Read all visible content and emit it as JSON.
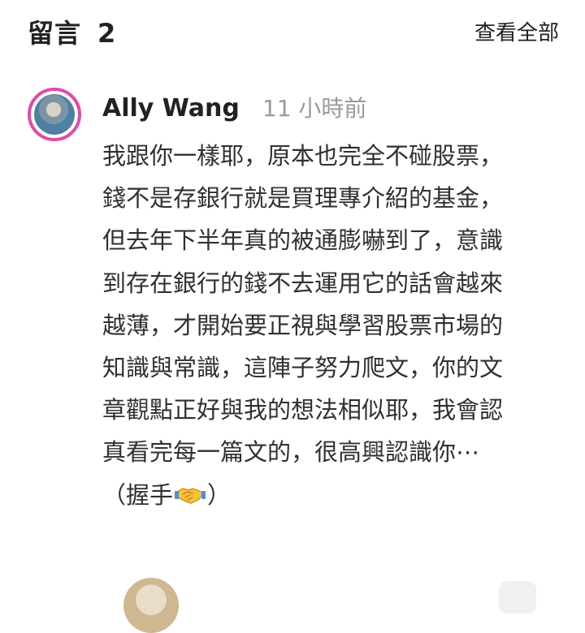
{
  "header": {
    "title": "留言",
    "count": "2",
    "view_all": "查看全部"
  },
  "comment": {
    "author": "Ally Wang",
    "time": "11 小時前",
    "lines": [
      "我跟你一樣耶，原本也完全不碰股票，",
      "錢不是存銀行就是買理專介紹的基金，",
      "但去年下半年真的被通膨嚇到了，意識",
      "到存在銀行的錢不去運用它的話會越來",
      "越薄，才開始要正視與學習股票市場的",
      "知識與常識，這陣子努力爬文，你的文",
      "章觀點正好與我的想法相似耶，我會認",
      "真看完每一篇文的，很高興認識你⋯"
    ],
    "last_open": "（握手",
    "last_close": "）",
    "emoji_icon": "handshake-icon"
  }
}
